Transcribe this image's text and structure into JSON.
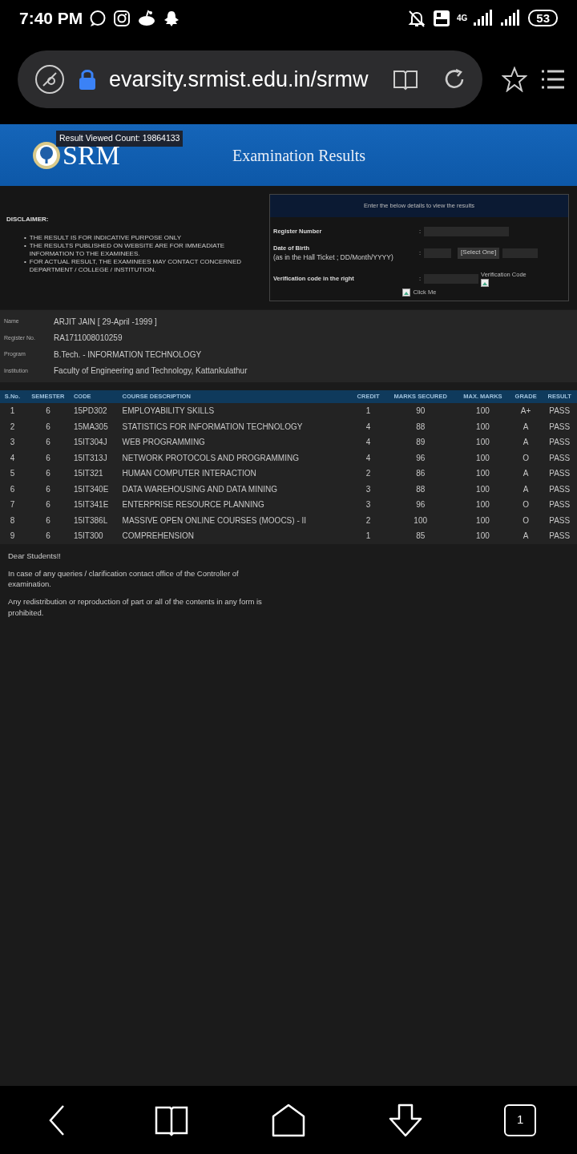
{
  "status_bar": {
    "time": "7:40 PM",
    "network": "4G",
    "battery": "53"
  },
  "browser": {
    "url": "evarsity.srmist.edu.in/srmw"
  },
  "banner": {
    "logo_text": "SRM",
    "title": "Examination Results",
    "tooltip": "Result Viewed Count: 19864133"
  },
  "disclaimer": {
    "heading": "DISCLAIMER:",
    "items": [
      {
        "bullet": "•",
        "text": "THE RESULT IS FOR INDICATIVE PURPOSE ONLY"
      },
      {
        "bullet": "•",
        "text": "THE RESULTS PUBLISHED ON WEBSITE ARE FOR IMMEADIATE INFORMATION TO THE EXAMINEES."
      },
      {
        "bullet": "•",
        "text": "FOR ACTUAL RESULT, THE EXAMINEES MAY CONTACT CONCERNED DEPARTMENT / COLLEGE / INSTITUTION."
      }
    ]
  },
  "form": {
    "heading": "Enter the below details to view the results",
    "fields": [
      {
        "kind": "text",
        "label": "Register Number",
        "colon": ":"
      },
      {
        "kind": "date",
        "label": "Date of Birth",
        "hint": "(as in the Hall Ticket ; DD/Month/YYYY)",
        "colon": ":",
        "select": "[Select One]"
      },
      {
        "kind": "captcha",
        "label": "Verification code in the right",
        "colon": ":",
        "image_alt": "Verification Code"
      }
    ],
    "button_alt": "Click Me"
  },
  "student": [
    {
      "label": "Name",
      "value": "ARJIT JAIN [ 29-April -1999 ]"
    },
    {
      "label": "Register No.",
      "value": "RA1711008010259"
    },
    {
      "label": "Program",
      "value": "B.Tech. - INFORMATION TECHNOLOGY"
    },
    {
      "label": "Institution",
      "value": "Faculty of Engineering and Technology, Kattankulathur"
    }
  ],
  "table": {
    "columns": [
      "S.No.",
      "SEMESTER",
      "CODE",
      "COURSE DESCRIPTION",
      "CREDIT",
      "MARKS SECURED",
      "MAX. MARKS",
      "GRADE",
      "RESULT"
    ],
    "rows": [
      [
        "1",
        "6",
        "15PD302",
        "EMPLOYABILITY SKILLS",
        "1",
        "90",
        "100",
        "A+",
        "PASS"
      ],
      [
        "2",
        "6",
        "15MA305",
        "STATISTICS FOR INFORMATION TECHNOLOGY",
        "4",
        "88",
        "100",
        "A",
        "PASS"
      ],
      [
        "3",
        "6",
        "15IT304J",
        "WEB PROGRAMMING",
        "4",
        "89",
        "100",
        "A",
        "PASS"
      ],
      [
        "4",
        "6",
        "15IT313J",
        "NETWORK PROTOCOLS AND PROGRAMMING",
        "4",
        "96",
        "100",
        "O",
        "PASS"
      ],
      [
        "5",
        "6",
        "15IT321",
        "HUMAN COMPUTER INTERACTION",
        "2",
        "86",
        "100",
        "A",
        "PASS"
      ],
      [
        "6",
        "6",
        "15IT340E",
        "DATA WAREHOUSING AND DATA MINING",
        "3",
        "88",
        "100",
        "A",
        "PASS"
      ],
      [
        "7",
        "6",
        "15IT341E",
        "ENTERPRISE RESOURCE PLANNING",
        "3",
        "96",
        "100",
        "O",
        "PASS"
      ],
      [
        "8",
        "6",
        "15IT386L",
        "MASSIVE OPEN ONLINE COURSES (MOOCS) - II",
        "2",
        "100",
        "100",
        "O",
        "PASS"
      ],
      [
        "9",
        "6",
        "15IT300",
        "COMPREHENSION",
        "1",
        "85",
        "100",
        "A",
        "PASS"
      ]
    ]
  },
  "notes": [
    "Dear Students!!",
    "In case of any queries / clarification contact office of the Controller of examination.",
    "Any redistribution or reproduction of part or all of the contents in any form is prohibited."
  ],
  "nav_bar": {
    "tab_count": "1"
  }
}
